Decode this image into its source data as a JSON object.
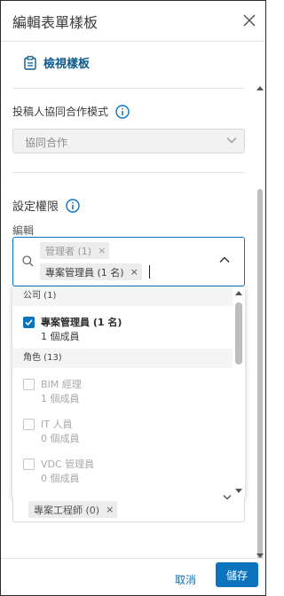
{
  "header": {
    "title": "編輯表單樣板",
    "close_icon": "close-icon"
  },
  "view_template": {
    "label": "檢視樣板",
    "icon": "clipboard-icon"
  },
  "collaboration": {
    "label": "投稿人協同合作模式",
    "info_icon": "info-icon",
    "value": "協同合作"
  },
  "permissions": {
    "label": "設定權限",
    "info_icon": "info-icon",
    "field_label": "編輯",
    "selected_chips": [
      {
        "label": "管理者 (1)",
        "remove": "×"
      },
      {
        "label": "專案管理員 (1 名)",
        "remove": "×"
      }
    ],
    "dropdown": {
      "groups": [
        {
          "title": "公司 (1)"
        },
        {
          "title": "角色 (13)"
        }
      ],
      "options": [
        {
          "name": "專案管理員 (1 名)",
          "sub": "1 個成員",
          "checked": true
        },
        {
          "name": "BIM 經理",
          "sub": "1 個成員",
          "checked": false
        },
        {
          "name": "IT 人員",
          "sub": "0 個成員",
          "checked": false
        },
        {
          "name": "VDC 管理員",
          "sub": "0 個成員",
          "checked": false
        }
      ]
    },
    "next_field_chip": {
      "label": "專案工程師 (0)",
      "remove": "×"
    }
  },
  "footer": {
    "cancel_label": "取消",
    "save_label": "儲存"
  },
  "colors": {
    "accent": "#0c73bf",
    "link": "#0c5a8e",
    "disabled_text": "#a8a8a8"
  }
}
